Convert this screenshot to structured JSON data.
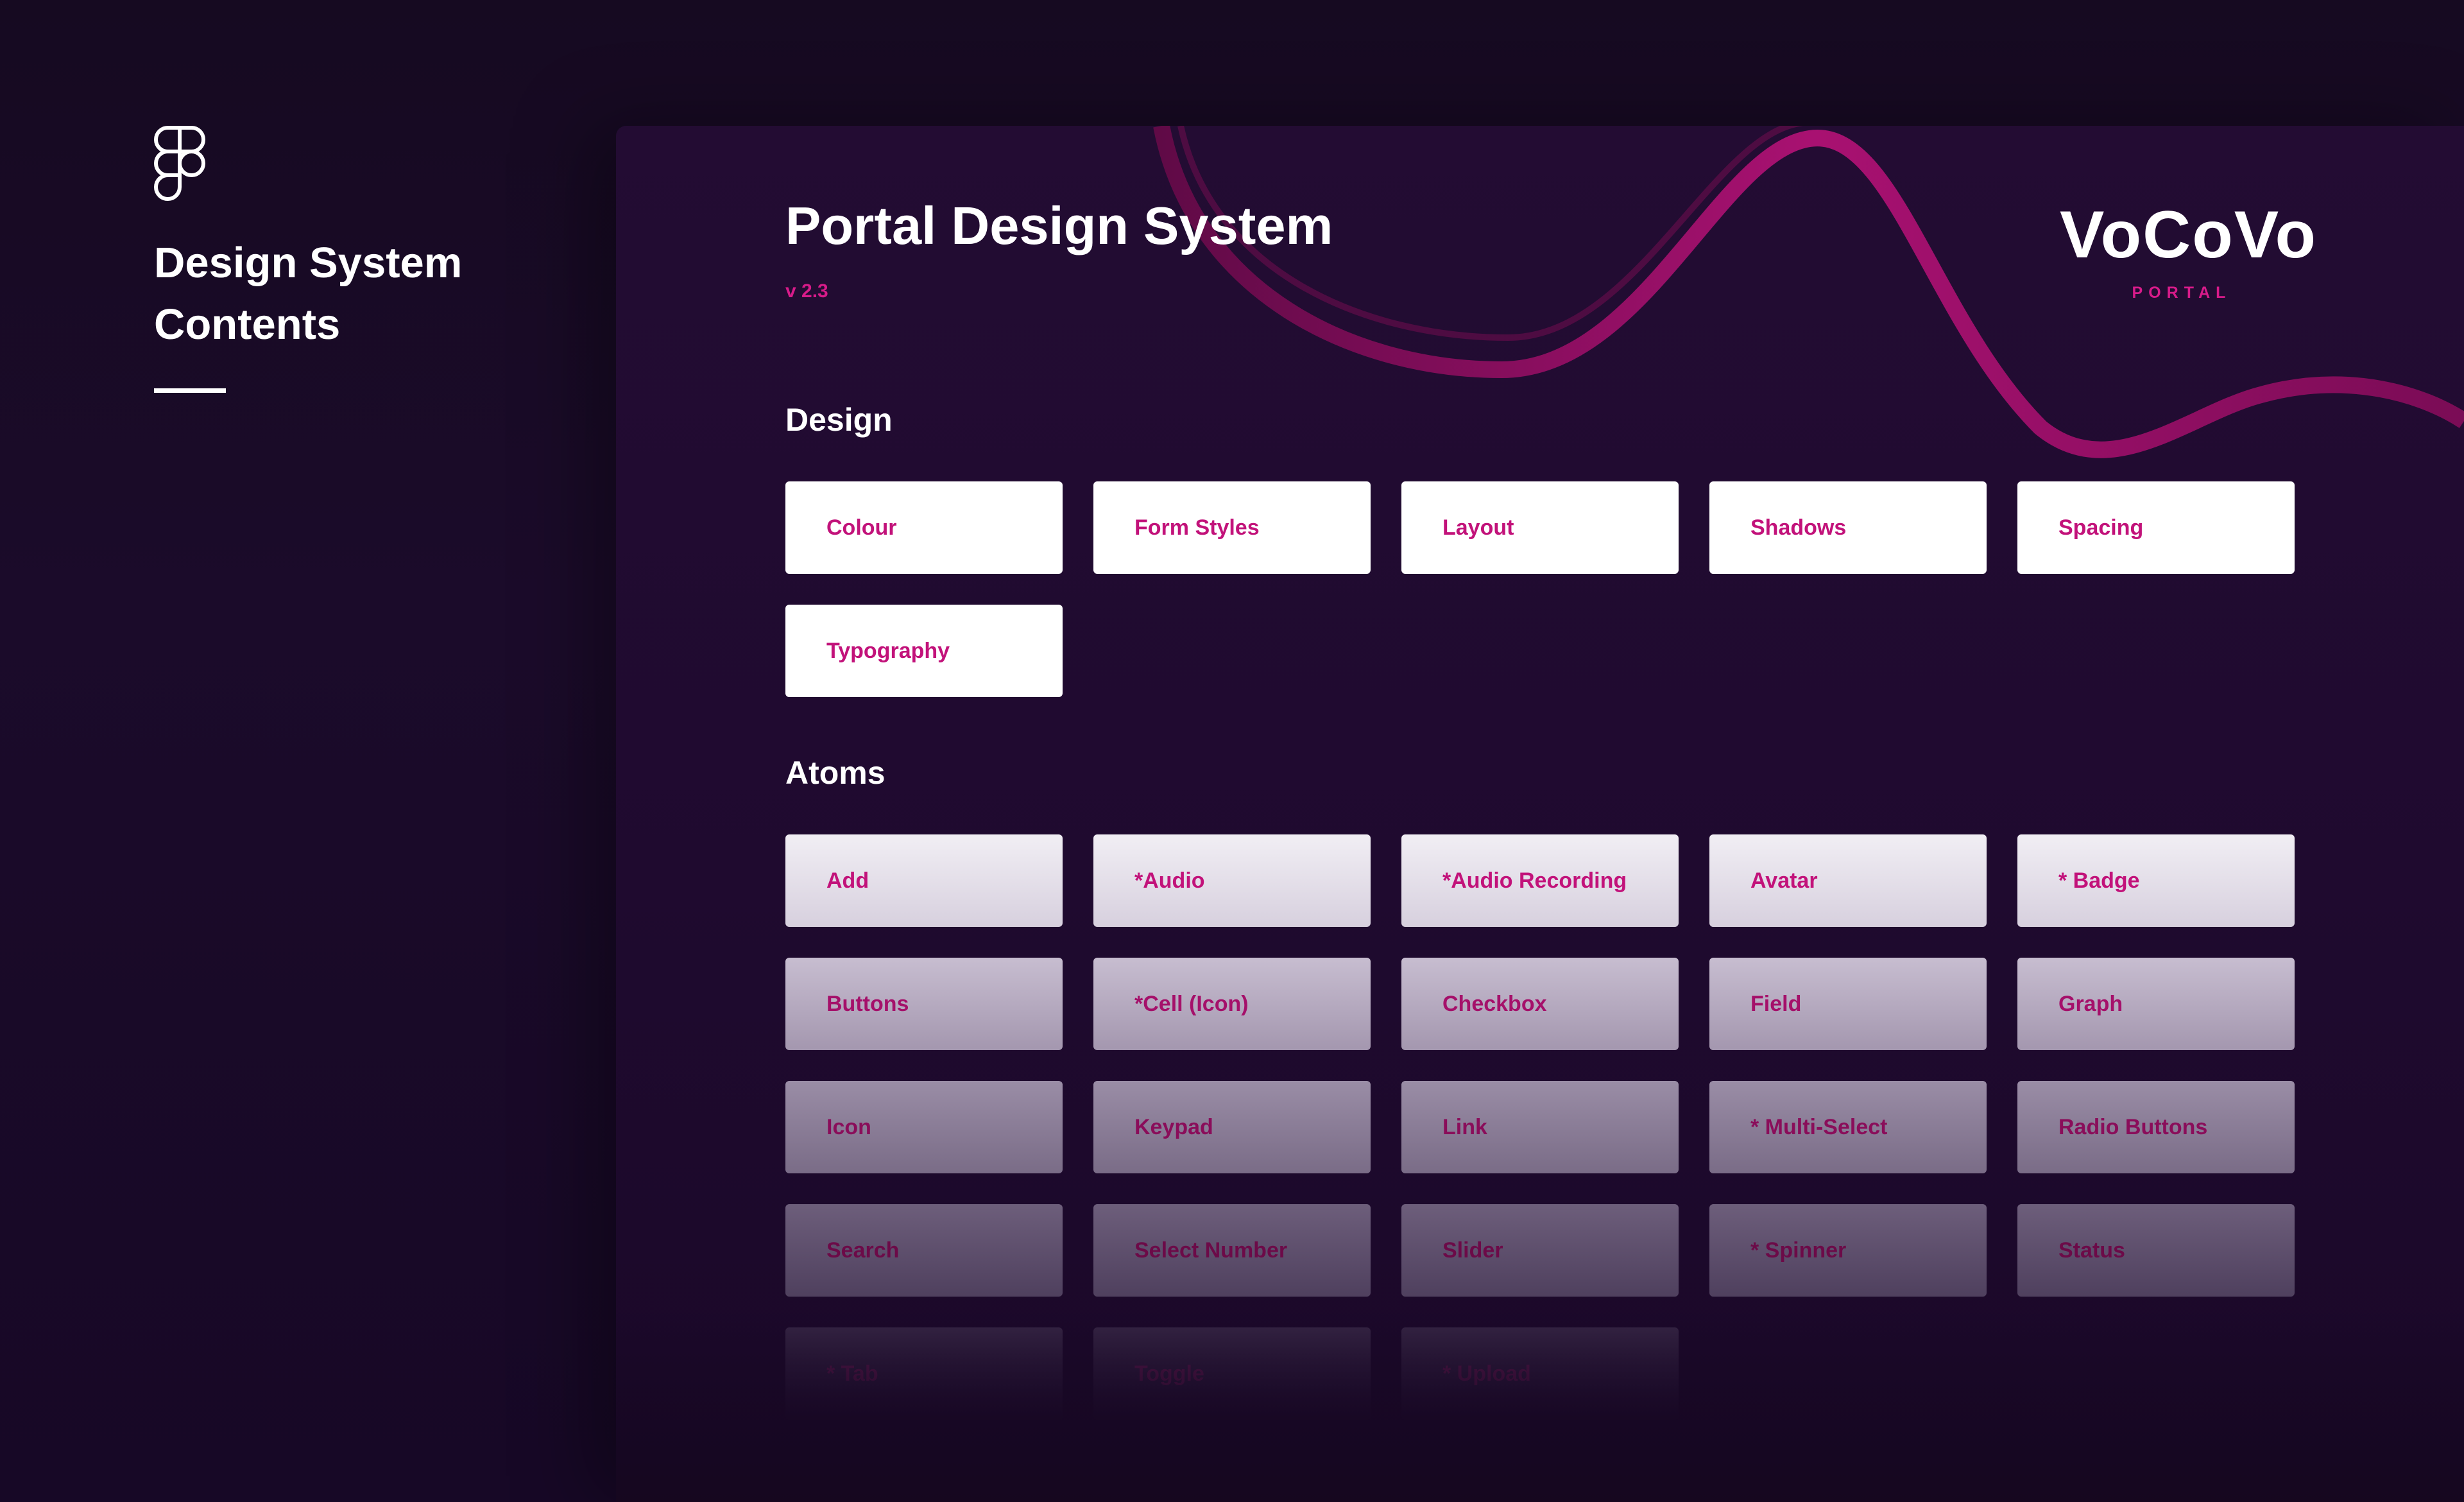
{
  "sidebar": {
    "logo_icon": "figma-icon",
    "title_line1": "Design System",
    "title_line2": "Contents"
  },
  "header": {
    "title": "Portal Design System",
    "version": "v 2.3"
  },
  "brand": {
    "name": "VoCoVo",
    "subtitle": "PORTAL"
  },
  "design": {
    "heading": "Design",
    "items": [
      "Colour",
      "Form Styles",
      "Layout",
      "Shadows",
      "Spacing",
      "Typography"
    ]
  },
  "atoms": {
    "heading": "Atoms",
    "items": [
      "Add",
      "*Audio",
      "*Audio Recording",
      "Avatar",
      "* Badge",
      "Buttons",
      "*Cell (Icon)",
      "Checkbox",
      "Field",
      "Graph",
      "Icon",
      "Keypad",
      "Link",
      "* Multi-Select",
      "Radio Buttons",
      "Search",
      "Select Number",
      "Slider",
      "* Spinner",
      "Status",
      "* Tab",
      "Toggle",
      "* Upload"
    ]
  },
  "colors": {
    "background": "#170a22",
    "canvas": "#230c33",
    "accent": "#d81b8a",
    "tile_text": "#c2127a"
  }
}
